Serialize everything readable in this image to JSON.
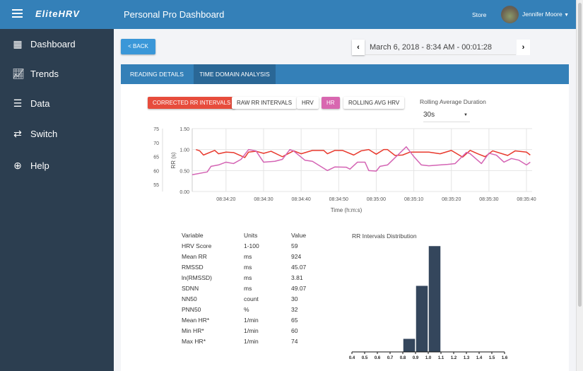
{
  "header": {
    "logo": "EliteHRV",
    "title": "Personal Pro Dashboard",
    "store": "Store",
    "user": "Jennifer Moore"
  },
  "sidebar": {
    "items": [
      {
        "label": "Dashboard",
        "icon": "grid-icon"
      },
      {
        "label": "Trends",
        "icon": "chart-line-icon"
      },
      {
        "label": "Data",
        "icon": "server-icon"
      },
      {
        "label": "Switch",
        "icon": "users-switch-icon"
      },
      {
        "label": "Help",
        "icon": "life-ring-icon"
      }
    ]
  },
  "main": {
    "back": "< BACK",
    "date": "March 6, 2018 - 8:34 AM - 00:01:28",
    "tabs": [
      {
        "label": "READING DETAILS"
      },
      {
        "label": "TIME DOMAIN ANALYSIS",
        "active": true
      }
    ],
    "toggles": [
      {
        "label": "CORRECTED RR INTERVALS",
        "color": "#e74c3c"
      },
      {
        "label": "RAW RR INTERVALS"
      },
      {
        "label": "HRV"
      },
      {
        "label": "HR",
        "color": "#d867b0"
      },
      {
        "label": "ROLLING AVG HRV"
      }
    ],
    "rolling_label": "Rolling Average Duration",
    "rolling_value": "30s"
  },
  "stats": {
    "headers": [
      "Variable",
      "Units",
      "Value"
    ],
    "rows": [
      [
        "HRV Score",
        "1-100",
        "59"
      ],
      [
        "Mean RR",
        "ms",
        "924"
      ],
      [
        "RMSSD",
        "ms",
        "45.07"
      ],
      [
        "ln(RMSSD)",
        "ms",
        "3.81"
      ],
      [
        "SDNN",
        "ms",
        "49.07"
      ],
      [
        "NN50",
        "count",
        "30"
      ],
      [
        "PNN50",
        "%",
        "32"
      ],
      [
        "Mean HR*",
        "1/min",
        "65"
      ],
      [
        "Min HR*",
        "1/min",
        "60"
      ],
      [
        "Max HR*",
        "1/min",
        "74"
      ]
    ]
  },
  "chart_data": [
    {
      "type": "line",
      "xlabel": "Time (h:m:s)",
      "ylabel": "RR (s)",
      "grid": true,
      "x_ticks": [
        "08:34:20",
        "08:34:30",
        "08:34:40",
        "08:34:50",
        "08:35:00",
        "08:35:10",
        "08:35:20",
        "08:35:30",
        "08:35:40"
      ],
      "y_ticks": [
        "0.00",
        "0.50",
        "1.00",
        "1.50"
      ],
      "ylim": [
        0,
        1.5
      ],
      "y2_ticks": [
        "55",
        "60",
        "65",
        "70",
        "75"
      ],
      "y2lim": [
        52.5,
        75
      ],
      "series": [
        {
          "name": "CORRECTED RR INTERVALS",
          "axis": "left",
          "color": "#e8392d",
          "points": [
            [
              "08:34:12",
              1.0
            ],
            [
              "08:34:13",
              0.97
            ],
            [
              "08:34:14",
              0.87
            ],
            [
              "08:34:17",
              0.98
            ],
            [
              "08:34:18",
              0.9
            ],
            [
              "08:34:20",
              0.94
            ],
            [
              "08:34:22",
              0.93
            ],
            [
              "08:34:25",
              0.81
            ],
            [
              "08:34:26",
              0.94
            ],
            [
              "08:34:28",
              0.96
            ],
            [
              "08:34:30",
              0.91
            ],
            [
              "08:34:32",
              0.96
            ],
            [
              "08:34:35",
              0.83
            ],
            [
              "08:34:38",
              0.97
            ],
            [
              "08:34:40",
              0.9
            ],
            [
              "08:34:43",
              0.98
            ],
            [
              "08:34:46",
              0.98
            ],
            [
              "08:34:47",
              0.9
            ],
            [
              "08:34:49",
              0.98
            ],
            [
              "08:34:51",
              0.98
            ],
            [
              "08:34:54",
              0.87
            ],
            [
              "08:34:56",
              0.97
            ],
            [
              "08:34:58",
              1.0
            ],
            [
              "08:35:00",
              0.89
            ],
            [
              "08:35:02",
              1.0
            ],
            [
              "08:35:03",
              1.0
            ],
            [
              "08:35:05",
              0.86
            ],
            [
              "08:35:07",
              0.87
            ],
            [
              "08:35:09",
              0.94
            ],
            [
              "08:35:14",
              0.94
            ],
            [
              "08:35:17",
              0.9
            ],
            [
              "08:35:20",
              0.98
            ],
            [
              "08:35:23",
              0.82
            ],
            [
              "08:35:25",
              0.98
            ],
            [
              "08:35:27",
              0.9
            ],
            [
              "08:35:29",
              0.83
            ],
            [
              "08:35:31",
              0.97
            ],
            [
              "08:35:35",
              0.86
            ],
            [
              "08:35:37",
              0.97
            ],
            [
              "08:35:40",
              0.94
            ],
            [
              "08:35:41",
              0.87
            ]
          ]
        },
        {
          "name": "HR",
          "axis": "right",
          "color": "#d464b4",
          "points": [
            [
              "08:34:11",
              58.5
            ],
            [
              "08:34:15",
              59.5
            ],
            [
              "08:34:16",
              61.5
            ],
            [
              "08:34:18",
              62
            ],
            [
              "08:34:20",
              63
            ],
            [
              "08:34:22",
              62.5
            ],
            [
              "08:34:24",
              64
            ],
            [
              "08:34:26",
              67.5
            ],
            [
              "08:34:28",
              67
            ],
            [
              "08:34:30",
              63
            ],
            [
              "08:34:33",
              63.3
            ],
            [
              "08:34:35",
              64
            ],
            [
              "08:34:37",
              67.5
            ],
            [
              "08:34:38",
              67
            ],
            [
              "08:34:41",
              63.7
            ],
            [
              "08:34:43",
              63.3
            ],
            [
              "08:34:47",
              60
            ],
            [
              "08:34:49",
              61.3
            ],
            [
              "08:34:52",
              61.2
            ],
            [
              "08:34:53",
              60.5
            ],
            [
              "08:34:55",
              63
            ],
            [
              "08:34:57",
              63
            ],
            [
              "08:34:58",
              60
            ],
            [
              "08:35:00",
              59.8
            ],
            [
              "08:35:01",
              61.5
            ],
            [
              "08:35:03",
              62
            ],
            [
              "08:35:08",
              68.5
            ],
            [
              "08:35:10",
              65
            ],
            [
              "08:35:12",
              62
            ],
            [
              "08:35:14",
              61.7
            ],
            [
              "08:35:17",
              62
            ],
            [
              "08:35:19",
              62.2
            ],
            [
              "08:35:21",
              62.5
            ],
            [
              "08:35:24",
              66.5
            ],
            [
              "08:35:25",
              66
            ],
            [
              "08:35:28",
              62.5
            ],
            [
              "08:35:30",
              66.2
            ],
            [
              "08:35:32",
              65.5
            ],
            [
              "08:35:34",
              63
            ],
            [
              "08:35:36",
              64.3
            ],
            [
              "08:35:38",
              63.7
            ],
            [
              "08:35:40",
              62
            ],
            [
              "08:35:41",
              63
            ]
          ]
        }
      ]
    },
    {
      "type": "bar",
      "title": "RR Intervals Distribution",
      "x_ticks": [
        "0.4",
        "0.5",
        "0.6",
        "0.7",
        "0.8",
        "0.9",
        "1.0",
        "1.1",
        "1.2",
        "1.3",
        "1.4",
        "1.5",
        "1.6"
      ],
      "xlim": [
        0.4,
        1.6
      ],
      "bins": [
        [
          0.8,
          0.9
        ],
        [
          0.9,
          1.0
        ],
        [
          1.0,
          1.1
        ]
      ],
      "values": [
        2,
        10,
        16
      ],
      "color": "#34465c"
    }
  ]
}
